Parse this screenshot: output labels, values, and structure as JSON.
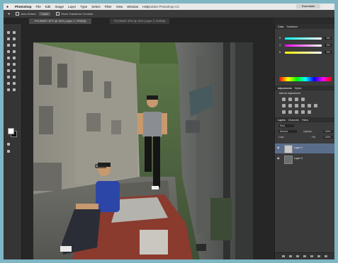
{
  "menubar": {
    "apple": "",
    "app_name": "Photoshop",
    "items": [
      "File",
      "Edit",
      "Image",
      "Layer",
      "Type",
      "Select",
      "Filter",
      "View",
      "Window",
      "Help"
    ],
    "window_title": "Adobe Photoshop CC",
    "workspace_button": "Essentials"
  },
  "options_bar": {
    "auto_select_label": "Auto-Select:",
    "auto_select_value": "Layer",
    "show_transform_label": "Show Transform Controls"
  },
  "document": {
    "tab_title": "P1130857.JPG @ 16% (Layer 1, RGB/8)",
    "tab_title_2": "P1130857.JPG @ 16% (Layer 2, RGB/8)"
  },
  "panels": {
    "color_tabs": [
      "Color",
      "Swatches"
    ],
    "rgb": [
      {
        "label": "R",
        "value": "255"
      },
      {
        "label": "G",
        "value": "255"
      },
      {
        "label": "B",
        "value": "255"
      }
    ],
    "adjust_tabs": [
      "Adjustments",
      "Styles"
    ],
    "adjust_title": "Add an adjustment",
    "layers_tabs": [
      "Layers",
      "Channels",
      "Paths"
    ],
    "filter_label": "Kind",
    "blend_mode": "Normal",
    "opacity_label": "Opacity:",
    "opacity_value": "100%",
    "lock_label": "Lock:",
    "fill_label": "Fill:",
    "fill_value": "100%",
    "layers": [
      {
        "name": "Layer 1",
        "selected": true
      },
      {
        "name": "Layer 0",
        "selected": false
      }
    ]
  },
  "colors": {
    "selection": "#5a6e8c",
    "foreground": "#ffffff",
    "background": "#111111"
  }
}
